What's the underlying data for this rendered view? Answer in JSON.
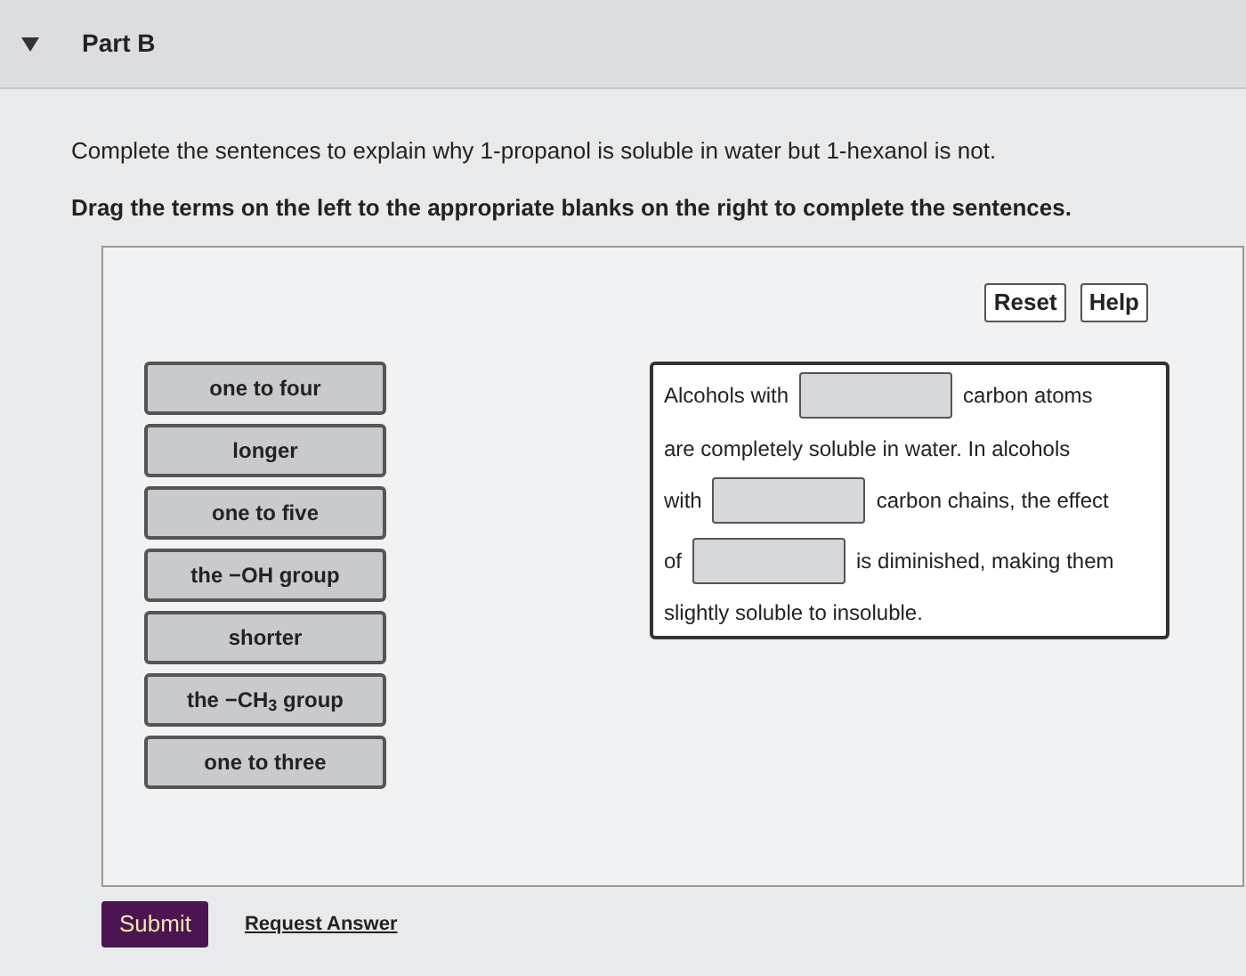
{
  "part": {
    "title": "Part B",
    "expanded": true
  },
  "instructions": "Complete the sentences to explain why 1-propanol is soluble in water but 1-hexanol is not.",
  "directions": "Drag the terms on the left to the appropriate blanks on the right to complete the sentences.",
  "tool_buttons": [
    "Reset",
    "Help"
  ],
  "terms": [
    "one to four",
    "longer",
    "one to five",
    "the −OH group",
    "shorter",
    "the −CH$_{3}$ group",
    "one to three"
  ],
  "sentence_lines": [
    [
      {
        "kind": "text",
        "text": "Alcohols with"
      },
      {
        "kind": "blank"
      },
      {
        "kind": "text",
        "text": "carbon atoms"
      }
    ],
    [
      {
        "kind": "text",
        "text": "are completely soluble in water. In alcohols"
      }
    ],
    [
      {
        "kind": "text",
        "text": "with"
      },
      {
        "kind": "blank"
      },
      {
        "kind": "text",
        "text": "carbon chains, the effect"
      }
    ],
    [
      {
        "kind": "text",
        "text": "of"
      },
      {
        "kind": "blank"
      },
      {
        "kind": "text",
        "text": "is diminished, making them"
      }
    ],
    [
      {
        "kind": "text",
        "text": "slightly soluble to insoluble."
      }
    ]
  ],
  "submit": "Submit",
  "request_answer": "Request Answer"
}
